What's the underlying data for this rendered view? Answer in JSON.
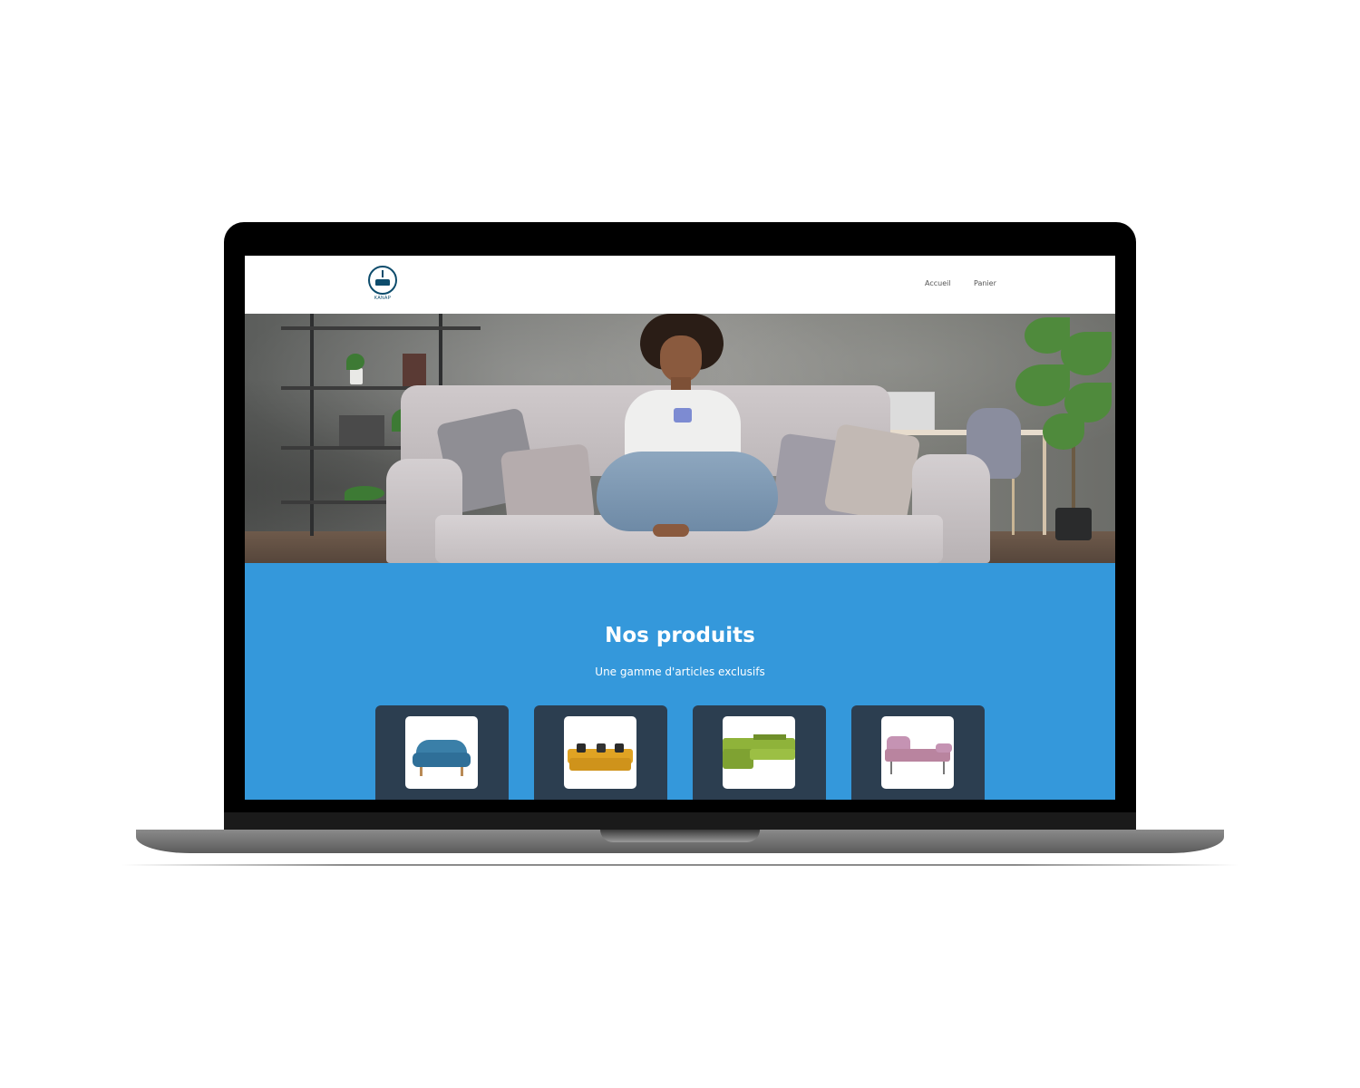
{
  "header": {
    "logo_text": "KANAP",
    "nav": {
      "home": "Accueil",
      "cart": "Panier"
    }
  },
  "products_section": {
    "title": "Nos produits",
    "subtitle": "Une gamme d'articles exclusifs"
  },
  "products": [
    {
      "name": "blue-armchair-sofa",
      "color": "#3a7fa8"
    },
    {
      "name": "yellow-sofa",
      "color": "#e0a323"
    },
    {
      "name": "green-sectional-sofa",
      "color": "#8fb33a"
    },
    {
      "name": "pink-chaise-sofa",
      "color": "#c593b3"
    }
  ],
  "colors": {
    "accent": "#3498db",
    "card": "#2c3e50",
    "logo": "#0d4c6c"
  }
}
